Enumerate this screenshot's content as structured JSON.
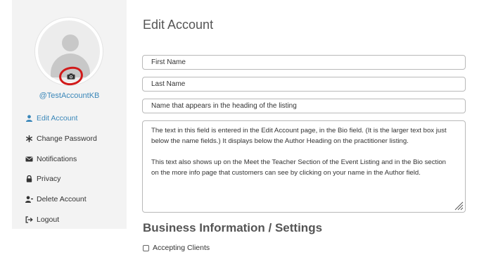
{
  "sidebar": {
    "username": "@TestAccountKB",
    "items": [
      {
        "label": "Edit Account",
        "icon": "user-icon",
        "active": true
      },
      {
        "label": "Change Password",
        "icon": "asterisk-icon",
        "active": false
      },
      {
        "label": "Notifications",
        "icon": "envelope-icon",
        "active": false
      },
      {
        "label": "Privacy",
        "icon": "lock-icon",
        "active": false
      },
      {
        "label": "Delete Account",
        "icon": "user-remove-icon",
        "active": false
      },
      {
        "label": "Logout",
        "icon": "sign-out-icon",
        "active": false
      }
    ]
  },
  "main": {
    "title": "Edit Account",
    "fields": {
      "first_name_placeholder": "First Name",
      "last_name_placeholder": "Last Name",
      "heading_name_placeholder": "Name that appears in the heading of the listing"
    },
    "bio": {
      "p1": "The text in this field is entered in the Edit Account page, in the Bio field. (It is the larger text box just below the name fields.) It displays below the Author Heading on the practitioner listing.",
      "p2": "This text also shows up on the Meet the Teacher Section of the Event Listing and in the Bio section on the more info page that customers can see by clicking on your name in the Author field."
    },
    "business_title": "Business Information / Settings",
    "accepting_clients_label": "Accepting Clients"
  },
  "colors": {
    "accent": "#3a87b9",
    "annotation_circle": "#d11a1a",
    "sidebar_bg": "#f3f3f3"
  }
}
